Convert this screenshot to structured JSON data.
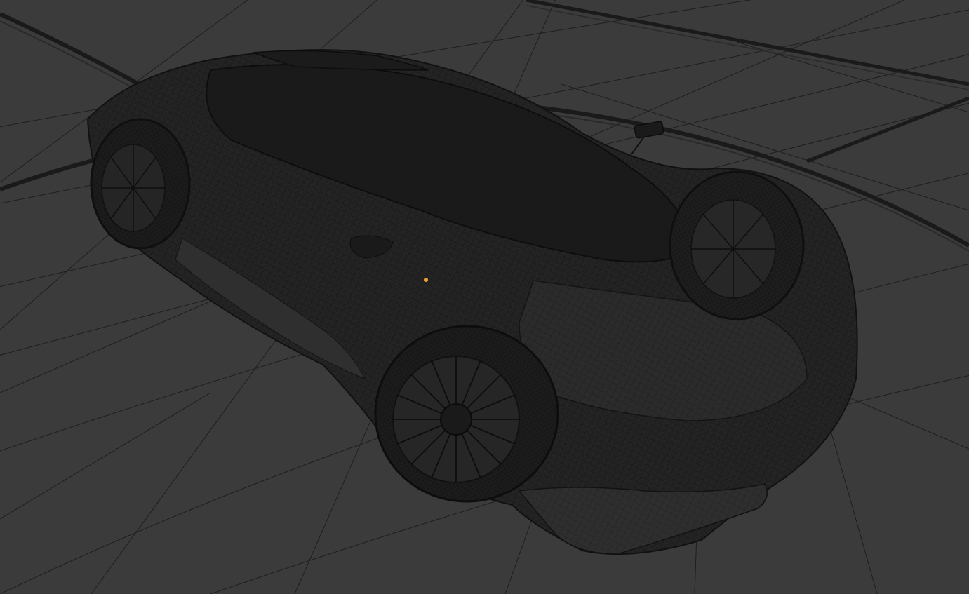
{
  "viewport": {
    "background_color": "#3b3b3b",
    "grid_line_color": "#1e1e1e",
    "wire_color": "#111111",
    "body_fill_color": "#232323",
    "origin_marker_color": "#f0a030"
  },
  "scene": {
    "object": "sports-car-wireframe",
    "shading": "wireframe",
    "icons": {
      "origin": "origin-dot-icon",
      "camera": "camera-object-icon"
    }
  }
}
